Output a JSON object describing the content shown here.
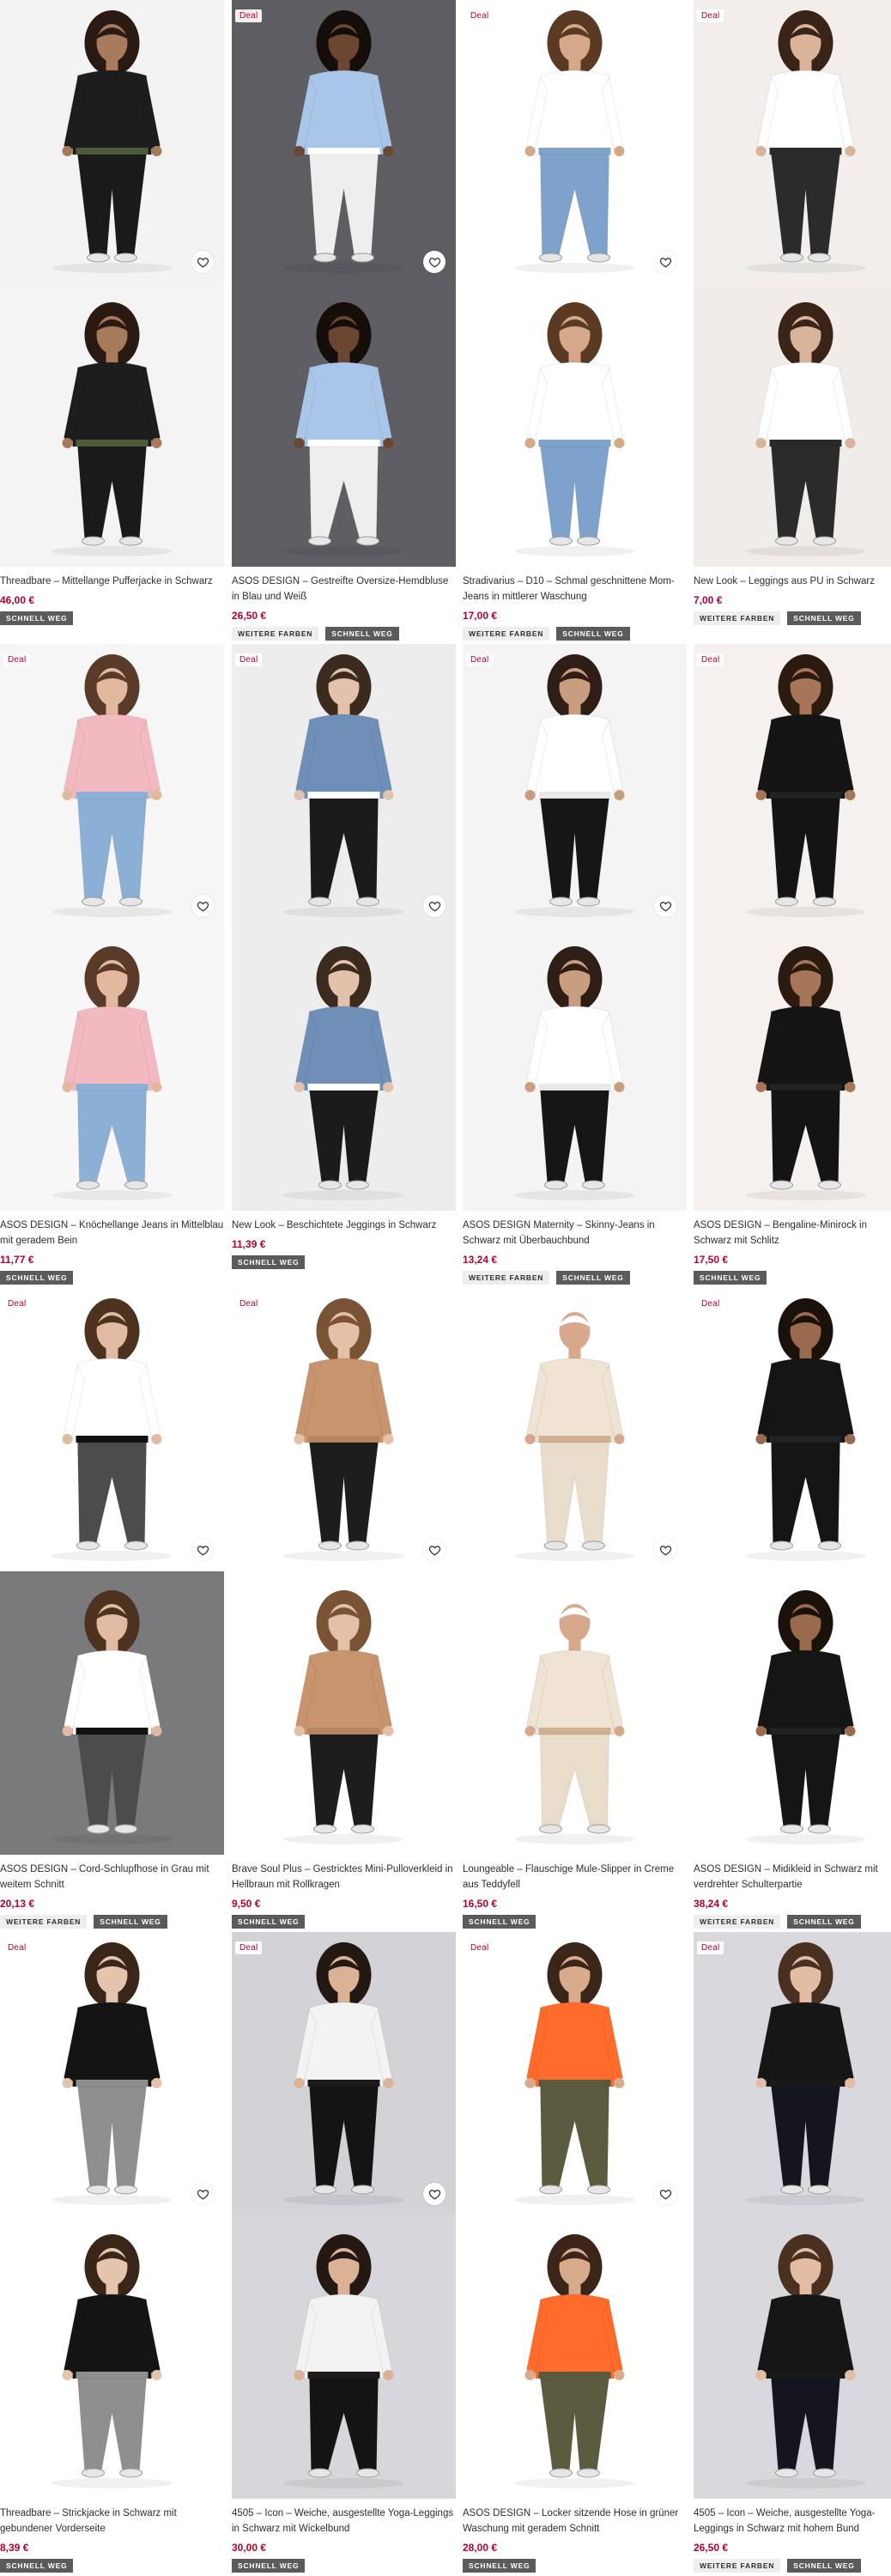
{
  "products": [
    {
      "deal": "Deal",
      "show_deal": false,
      "title": "Threadbare – Mittellange Pufferjacke in Schwarz",
      "price": "46,00 €",
      "tags": [
        "SCHNELL WEG"
      ],
      "colors": {
        "top_bg": "#f3f3f3",
        "bot_bg": "#f4f4f4",
        "garment": "#1d1d1d",
        "accent": "#4f5a3b",
        "skin": "#a67a5b",
        "hair": "#2a1a12",
        "pants": "#1a1a1a"
      }
    },
    {
      "deal": "Deal",
      "show_deal": true,
      "title": "ASOS DESIGN – Gestreifte Oversize-Hemdbluse in Blau und Weiß",
      "price": "26,50 €",
      "tags": [
        "WEITERE FARBEN",
        "SCHNELL WEG"
      ],
      "colors": {
        "top_bg": "#5e5d62",
        "bot_bg": "#5f5e63",
        "garment": "#a9c6e8",
        "accent": "#ffffff",
        "skin": "#6b4630",
        "hair": "#140d09",
        "pants": "#eeeeee"
      }
    },
    {
      "deal": "Deal",
      "show_deal": true,
      "title": "Stradivarius – D10 – Schmal geschnittene Mom-Jeans in mittlerer Waschung",
      "price": "17,00 €",
      "tags": [
        "WEITERE FARBEN",
        "SCHNELL WEG"
      ],
      "colors": {
        "top_bg": "#ffffff",
        "bot_bg": "#ffffff",
        "garment": "#ffffff",
        "accent": "#7fa3c9",
        "skin": "#d6a88a",
        "hair": "#5a3a22",
        "pants": "#7ea2cc"
      }
    },
    {
      "deal": "Deal",
      "show_deal": true,
      "title": "New Look – Leggings aus PU in Schwarz",
      "price": "7,00 €",
      "tags": [
        "WEITERE FARBEN",
        "SCHNELL WEG"
      ],
      "colors": {
        "top_bg": "#f1eeeb",
        "bot_bg": "#f0ece8",
        "garment": "#ffffff",
        "accent": "#2a2a2a",
        "skin": "#d9b39a",
        "hair": "#3a2418",
        "pants": "#2b2b2b"
      }
    },
    {
      "deal": "Deal",
      "show_deal": true,
      "title": "ASOS DESIGN – Knöchellange Jeans in Mittelblau mit geradem Bein",
      "price": "11,77 €",
      "tags": [
        "SCHNELL WEG"
      ],
      "colors": {
        "top_bg": "#f6f6f6",
        "bot_bg": "#f7f7f7",
        "garment": "#f2b9c0",
        "accent": "#8fb0d6",
        "skin": "#e2b99e",
        "hair": "#5a3a28",
        "pants": "#8cafd6"
      }
    },
    {
      "deal": "Deal",
      "show_deal": true,
      "title": "New Look – Beschichtete Jeggings in Schwarz",
      "price": "11,39 €",
      "tags": [
        "SCHNELL WEG"
      ],
      "colors": {
        "top_bg": "#ededed",
        "bot_bg": "#ededed",
        "garment": "#6f8fb8",
        "accent": "#ffffff",
        "skin": "#e2c1ad",
        "hair": "#3b2a1e",
        "pants": "#1b1b1b"
      }
    },
    {
      "deal": "Deal",
      "show_deal": true,
      "title": "ASOS DESIGN Maternity – Skinny-Jeans in Schwarz mit Überbauchbund",
      "price": "13,24 €",
      "tags": [
        "WEITERE FARBEN",
        "SCHNELL WEG"
      ],
      "colors": {
        "top_bg": "#f4f4f4",
        "bot_bg": "#f4f4f4",
        "garment": "#ffffff",
        "accent": "#e9e9e9",
        "skin": "#c99d80",
        "hair": "#2e1e15",
        "pants": "#161616"
      }
    },
    {
      "deal": "Deal",
      "show_deal": true,
      "title": "ASOS DESIGN – Bengaline-Minirock in Schwarz mit Schlitz",
      "price": "17,50 €",
      "tags": [
        "SCHNELL WEG"
      ],
      "colors": {
        "top_bg": "#f4f1ee",
        "bot_bg": "#f4f1ee",
        "garment": "#141414",
        "accent": "#222222",
        "skin": "#a77558",
        "hair": "#2a1a10",
        "pants": "#141414"
      }
    },
    {
      "deal": "Deal",
      "show_deal": true,
      "title": "ASOS DESIGN – Cord-Schlupfhose in Grau mit weitem Schnitt",
      "price": "20,13 €",
      "tags": [
        "WEITERE FARBEN",
        "SCHNELL WEG"
      ],
      "colors": {
        "top_bg": "#ffffff",
        "bot_bg": "#7a7a7c",
        "garment": "#ffffff",
        "accent": "#111111",
        "skin": "#e1bba1",
        "hair": "#4d3220",
        "pants": "#4c4c4e"
      }
    },
    {
      "deal": "Deal",
      "show_deal": true,
      "title": "Brave Soul Plus – Gestricktes Mini-Pulloverkleid in Hellbraun mit Rollkragen",
      "price": "9,50 €",
      "tags": [
        "SCHNELL WEG"
      ],
      "colors": {
        "top_bg": "#ffffff",
        "bot_bg": "#ffffff",
        "garment": "#c8946e",
        "accent": "#b68363",
        "skin": "#e4c0a6",
        "hair": "#7a5334",
        "pants": "#1d1d1d"
      }
    },
    {
      "deal": "Deal",
      "show_deal": false,
      "title": "Loungeable – Flauschige Mule-Slipper in Creme aus Teddyfell",
      "price": "16,50 €",
      "tags": [
        "SCHNELL WEG"
      ],
      "colors": {
        "top_bg": "#ffffff",
        "bot_bg": "#ffffff",
        "garment": "#efe3d3",
        "accent": "#cfb093",
        "skin": "#d7a88b",
        "hair": "#ffffff",
        "pants": "#e8dccb"
      }
    },
    {
      "deal": "Deal",
      "show_deal": true,
      "title": "ASOS DESIGN – Midikleid in Schwarz mit verdrehter Schulterpartie",
      "price": "38,24 €",
      "tags": [
        "WEITERE FARBEN",
        "SCHNELL WEG"
      ],
      "colors": {
        "top_bg": "#ffffff",
        "bot_bg": "#ffffff",
        "garment": "#151515",
        "accent": "#222222",
        "skin": "#9a6a4f",
        "hair": "#1a110b",
        "pants": "#151515"
      }
    },
    {
      "deal": "Deal",
      "show_deal": true,
      "title": "Threadbare – Strickjacke in Schwarz mit gebundener Vorderseite",
      "price": "8,39 €",
      "tags": [
        "SCHNELL WEG"
      ],
      "colors": {
        "top_bg": "#ffffff",
        "bot_bg": "#ffffff",
        "garment": "#141414",
        "accent": "#8e8e8e",
        "skin": "#e5c4ad",
        "hair": "#3a2519",
        "pants": "#8f8f8f"
      }
    },
    {
      "deal": "Deal",
      "show_deal": true,
      "title": "4505 – Icon – Weiche, ausgestellte Yoga-Leggings in Schwarz mit Wickelbund",
      "price": "30,00 €",
      "tags": [
        "SCHNELL WEG"
      ],
      "colors": {
        "top_bg": "#d3d2d6",
        "bot_bg": "#d7d6da",
        "garment": "#f3f3f3",
        "accent": "#1a1a1a",
        "skin": "#dcb296",
        "hair": "#241812",
        "pants": "#141414"
      }
    },
    {
      "deal": "Deal",
      "show_deal": true,
      "title": "ASOS DESIGN – Locker sitzende Hose in grüner Waschung mit geradem Schnitt",
      "price": "28,00 €",
      "tags": [
        "SCHNELL WEG"
      ],
      "colors": {
        "top_bg": "#ffffff",
        "bot_bg": "#ffffff",
        "garment": "#ff6b2a",
        "accent": "#5b5a3e",
        "skin": "#d8ab8d",
        "hair": "#3a2518",
        "pants": "#5c5b3f"
      }
    },
    {
      "deal": "Deal",
      "show_deal": true,
      "title": "4505 – Icon – Weiche, ausgestellte Yoga-Leggings in Schwarz mit hohem Bund",
      "price": "26,50 €",
      "tags": [
        "WEITERE FARBEN",
        "SCHNELL WEG"
      ],
      "colors": {
        "top_bg": "#d9d8dc",
        "bot_bg": "#d9d8dc",
        "garment": "#161616",
        "accent": "#1a1a1a",
        "skin": "#e2bda4",
        "hair": "#4a3020",
        "pants": "#151520"
      }
    }
  ],
  "colors": {
    "deal_red": "#b4002d",
    "price_red": "#b4002d",
    "tag_dark": "#5b5b5b",
    "tag_light": "#eeeeee"
  },
  "icons": {
    "wishlist": "heart-outline-icon"
  }
}
